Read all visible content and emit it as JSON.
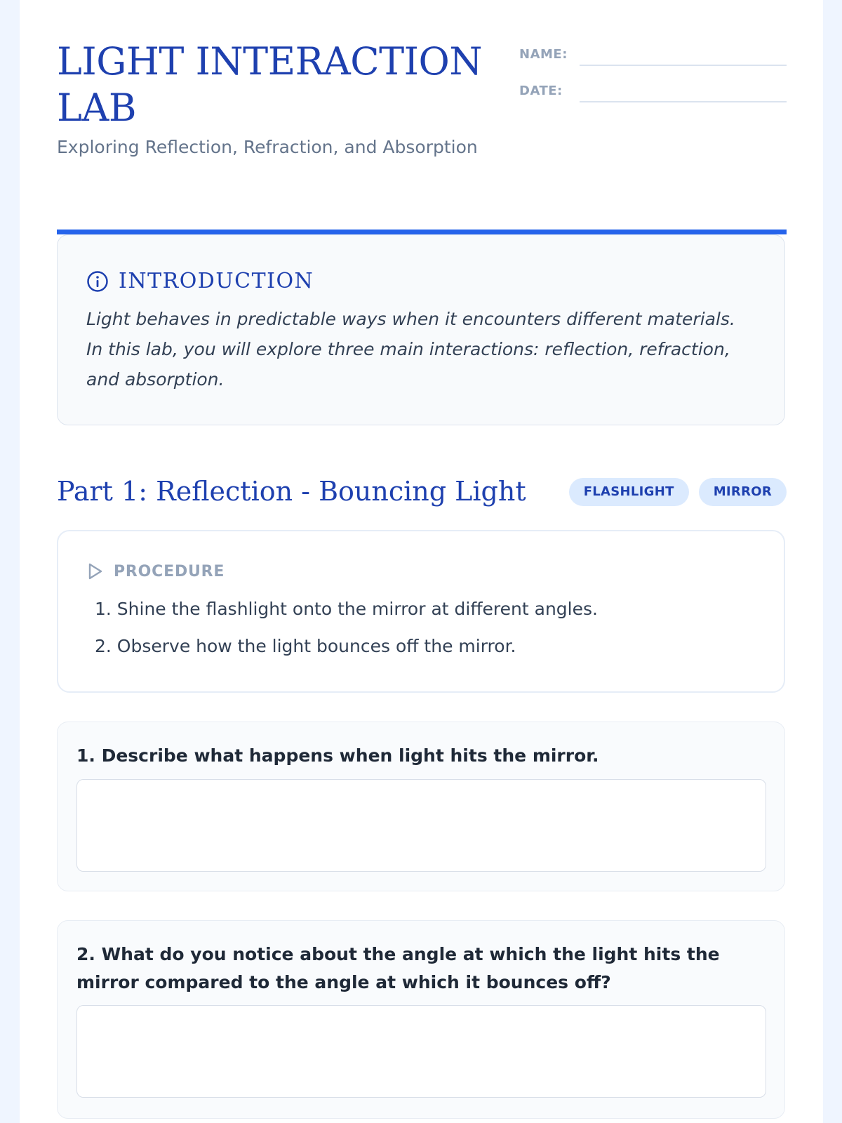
{
  "header": {
    "title": "LIGHT INTERACTION LAB",
    "subtitle": "Exploring Reflection, Refraction, and Absorption",
    "name_label": "NAME:",
    "date_label": "DATE:",
    "name_value": "",
    "date_value": ""
  },
  "intro": {
    "icon": "info-circle-icon",
    "title": "INTRODUCTION",
    "text": "Light behaves in predictable ways when it encounters different materials. In this lab, you will explore three main interactions: reflection, refraction, and absorption."
  },
  "part1": {
    "title": "Part 1: Reflection - Bouncing Light",
    "tags": [
      "FLASHLIGHT",
      "MIRROR"
    ],
    "procedure": {
      "icon": "play-triangle-icon",
      "title": "PROCEDURE",
      "steps": [
        "1. Shine the flashlight onto the mirror at different angles.",
        "2. Observe how the light bounces off the mirror."
      ]
    },
    "questions": [
      {
        "text": "1. Describe what happens when light hits the mirror.",
        "answer": ""
      },
      {
        "text": "2. What do you notice about the angle at which the light hits the mirror compared to the angle at which it bounces off?",
        "answer": ""
      }
    ]
  },
  "colors": {
    "background": "#eff5ff",
    "accent": "#2563eb",
    "heading": "#1e40af",
    "tag_background": "#dbeafe",
    "muted": "#94a3b8"
  }
}
